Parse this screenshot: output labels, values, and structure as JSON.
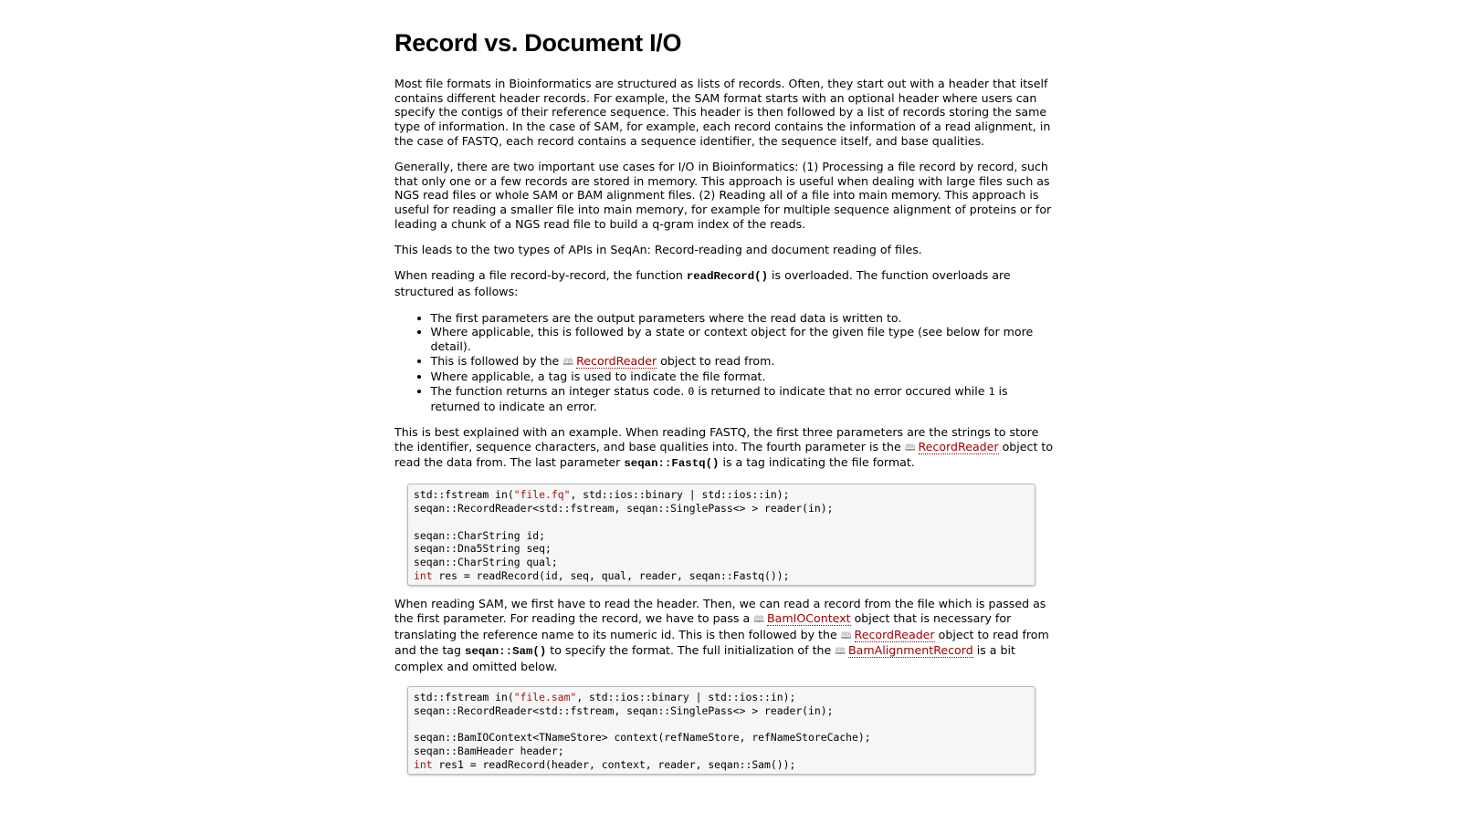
{
  "title": "Record vs. Document I/O",
  "p1": "Most file formats in Bioinformatics are structured as lists of records. Often, they start out with a header that itself contains different header records. For example, the SAM format starts with an optional header where users can specify the contigs of their reference sequence. This header is then followed by a list of records storing the same type of information. In the case of SAM, for example, each record contains the information of a read alignment, in the case of FASTQ, each record contains a sequence identifier, the sequence itself, and base qualities.",
  "p2": "Generally, there are two important use cases for I/O in Bioinformatics: (1) Processing a file record by record, such that only one or a few records are stored in memory. This approach is useful when dealing with large files such as NGS read files or whole SAM or BAM alignment files. (2) Reading all of a file into main memory. This approach is useful for reading a smaller file into main memory, for example for multiple sequence alignment of proteins or for leading a chunk of a NGS read file to build a q-gram index of the reads.",
  "p3": "This leads to the two types of APIs in SeqAn: Record-reading and document reading of files.",
  "p4": {
    "before": "When reading a file record-by-record, the function ",
    "code": "readRecord()",
    "after": " is overloaded. The function overloads are structured as follows:"
  },
  "bullets": {
    "b1": "The first parameters are the output parameters where the read data is written to.",
    "b2": "Where applicable, this is followed by a state or context object for the given file type (see below for more detail).",
    "b3_before": "This is followed by the ",
    "b3_link": "RecordReader",
    "b3_after": " object to read from.",
    "b4": "Where applicable, a tag is used to indicate the file format.",
    "b5_before": "The function returns an integer status code. ",
    "b5_code1": "0",
    "b5_mid": " is returned to indicate that no error occured while ",
    "b5_code2": "1",
    "b5_after": " is returned to indicate an error."
  },
  "p5": {
    "before": "This is best explained with an example. When reading FASTQ, the first three parameters are the strings to store the identifier, sequence characters, and base qualities into. The fourth parameter is the ",
    "link": "RecordReader",
    "mid": " object to read the data from. The last parameter ",
    "code": "seqan::Fastq()",
    "after": " is a tag indicating the file format."
  },
  "code1": {
    "l1a": "std::fstream in(",
    "l1s": "\"file.fq\"",
    "l1b": ", std::ios::binary | std::ios::in);",
    "l2": "seqan::RecordReader<std::fstream, seqan::SinglePass<> > reader(in);",
    "l3": "",
    "l4": "seqan::CharString id;",
    "l5": "seqan::Dna5String seq;",
    "l6": "seqan::CharString qual;",
    "l7k": "int",
    "l7": " res = readRecord(id, seq, qual, reader, seqan::Fastq());"
  },
  "p6": {
    "t1": "When reading SAM, we first have to read the header. Then, we can read a record from the file which is passed as the first parameter. For reading the record, we have to pass a ",
    "link1": "BamIOContext",
    "t2": " object that is necessary for translating the reference name to its numeric id. This is then followed by the ",
    "link2": "RecordReader",
    "t3": " object to read from and the tag ",
    "code": "seqan::Sam()",
    "t4": " to specify the format. The full initialization of the ",
    "link3": "BamAlignmentRecord",
    "t5": " is a bit complex and omitted below."
  },
  "code2": {
    "l1a": "std::fstream in(",
    "l1s": "\"file.sam\"",
    "l1b": ", std::ios::binary | std::ios::in);",
    "l2": "seqan::RecordReader<std::fstream, seqan::SinglePass<> > reader(in);",
    "l3": "",
    "l4": "seqan::BamIOContext<TNameStore> context(refNameStore, refNameStoreCache);",
    "l5": "seqan::BamHeader header;",
    "l6k": "int",
    "l6": " res1 = readRecord(header, context, reader, seqan::Sam());"
  }
}
